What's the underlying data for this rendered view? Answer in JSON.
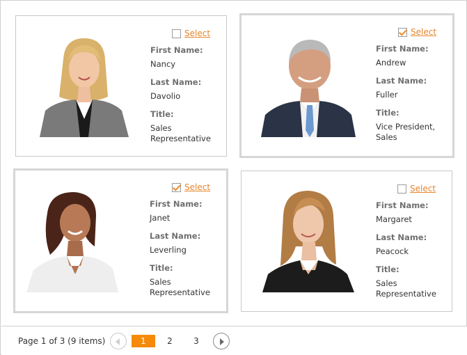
{
  "cards": [
    {
      "selected": false,
      "select_label": "Select",
      "first_name_label": "First Name:",
      "first_name": "Nancy",
      "last_name_label": "Last Name:",
      "last_name": "Davolio",
      "title_label": "Title:",
      "title": "Sales Representative"
    },
    {
      "selected": true,
      "select_label": "Select",
      "first_name_label": "First Name:",
      "first_name": "Andrew",
      "last_name_label": "Last Name:",
      "last_name": "Fuller",
      "title_label": "Title:",
      "title": "Vice President, Sales"
    },
    {
      "selected": true,
      "select_label": "Select",
      "first_name_label": "First Name:",
      "first_name": "Janet",
      "last_name_label": "Last Name:",
      "last_name": "Leverling",
      "title_label": "Title:",
      "title": "Sales Representative"
    },
    {
      "selected": false,
      "select_label": "Select",
      "first_name_label": "First Name:",
      "first_name": "Margaret",
      "last_name_label": "Last Name:",
      "last_name": "Peacock",
      "title_label": "Title:",
      "title": "Sales Representative"
    }
  ],
  "pager": {
    "info": "Page 1 of 3 (9 items)",
    "pages": [
      "1",
      "2",
      "3"
    ],
    "current_page": "1",
    "accent_color": "#f58a0b"
  }
}
